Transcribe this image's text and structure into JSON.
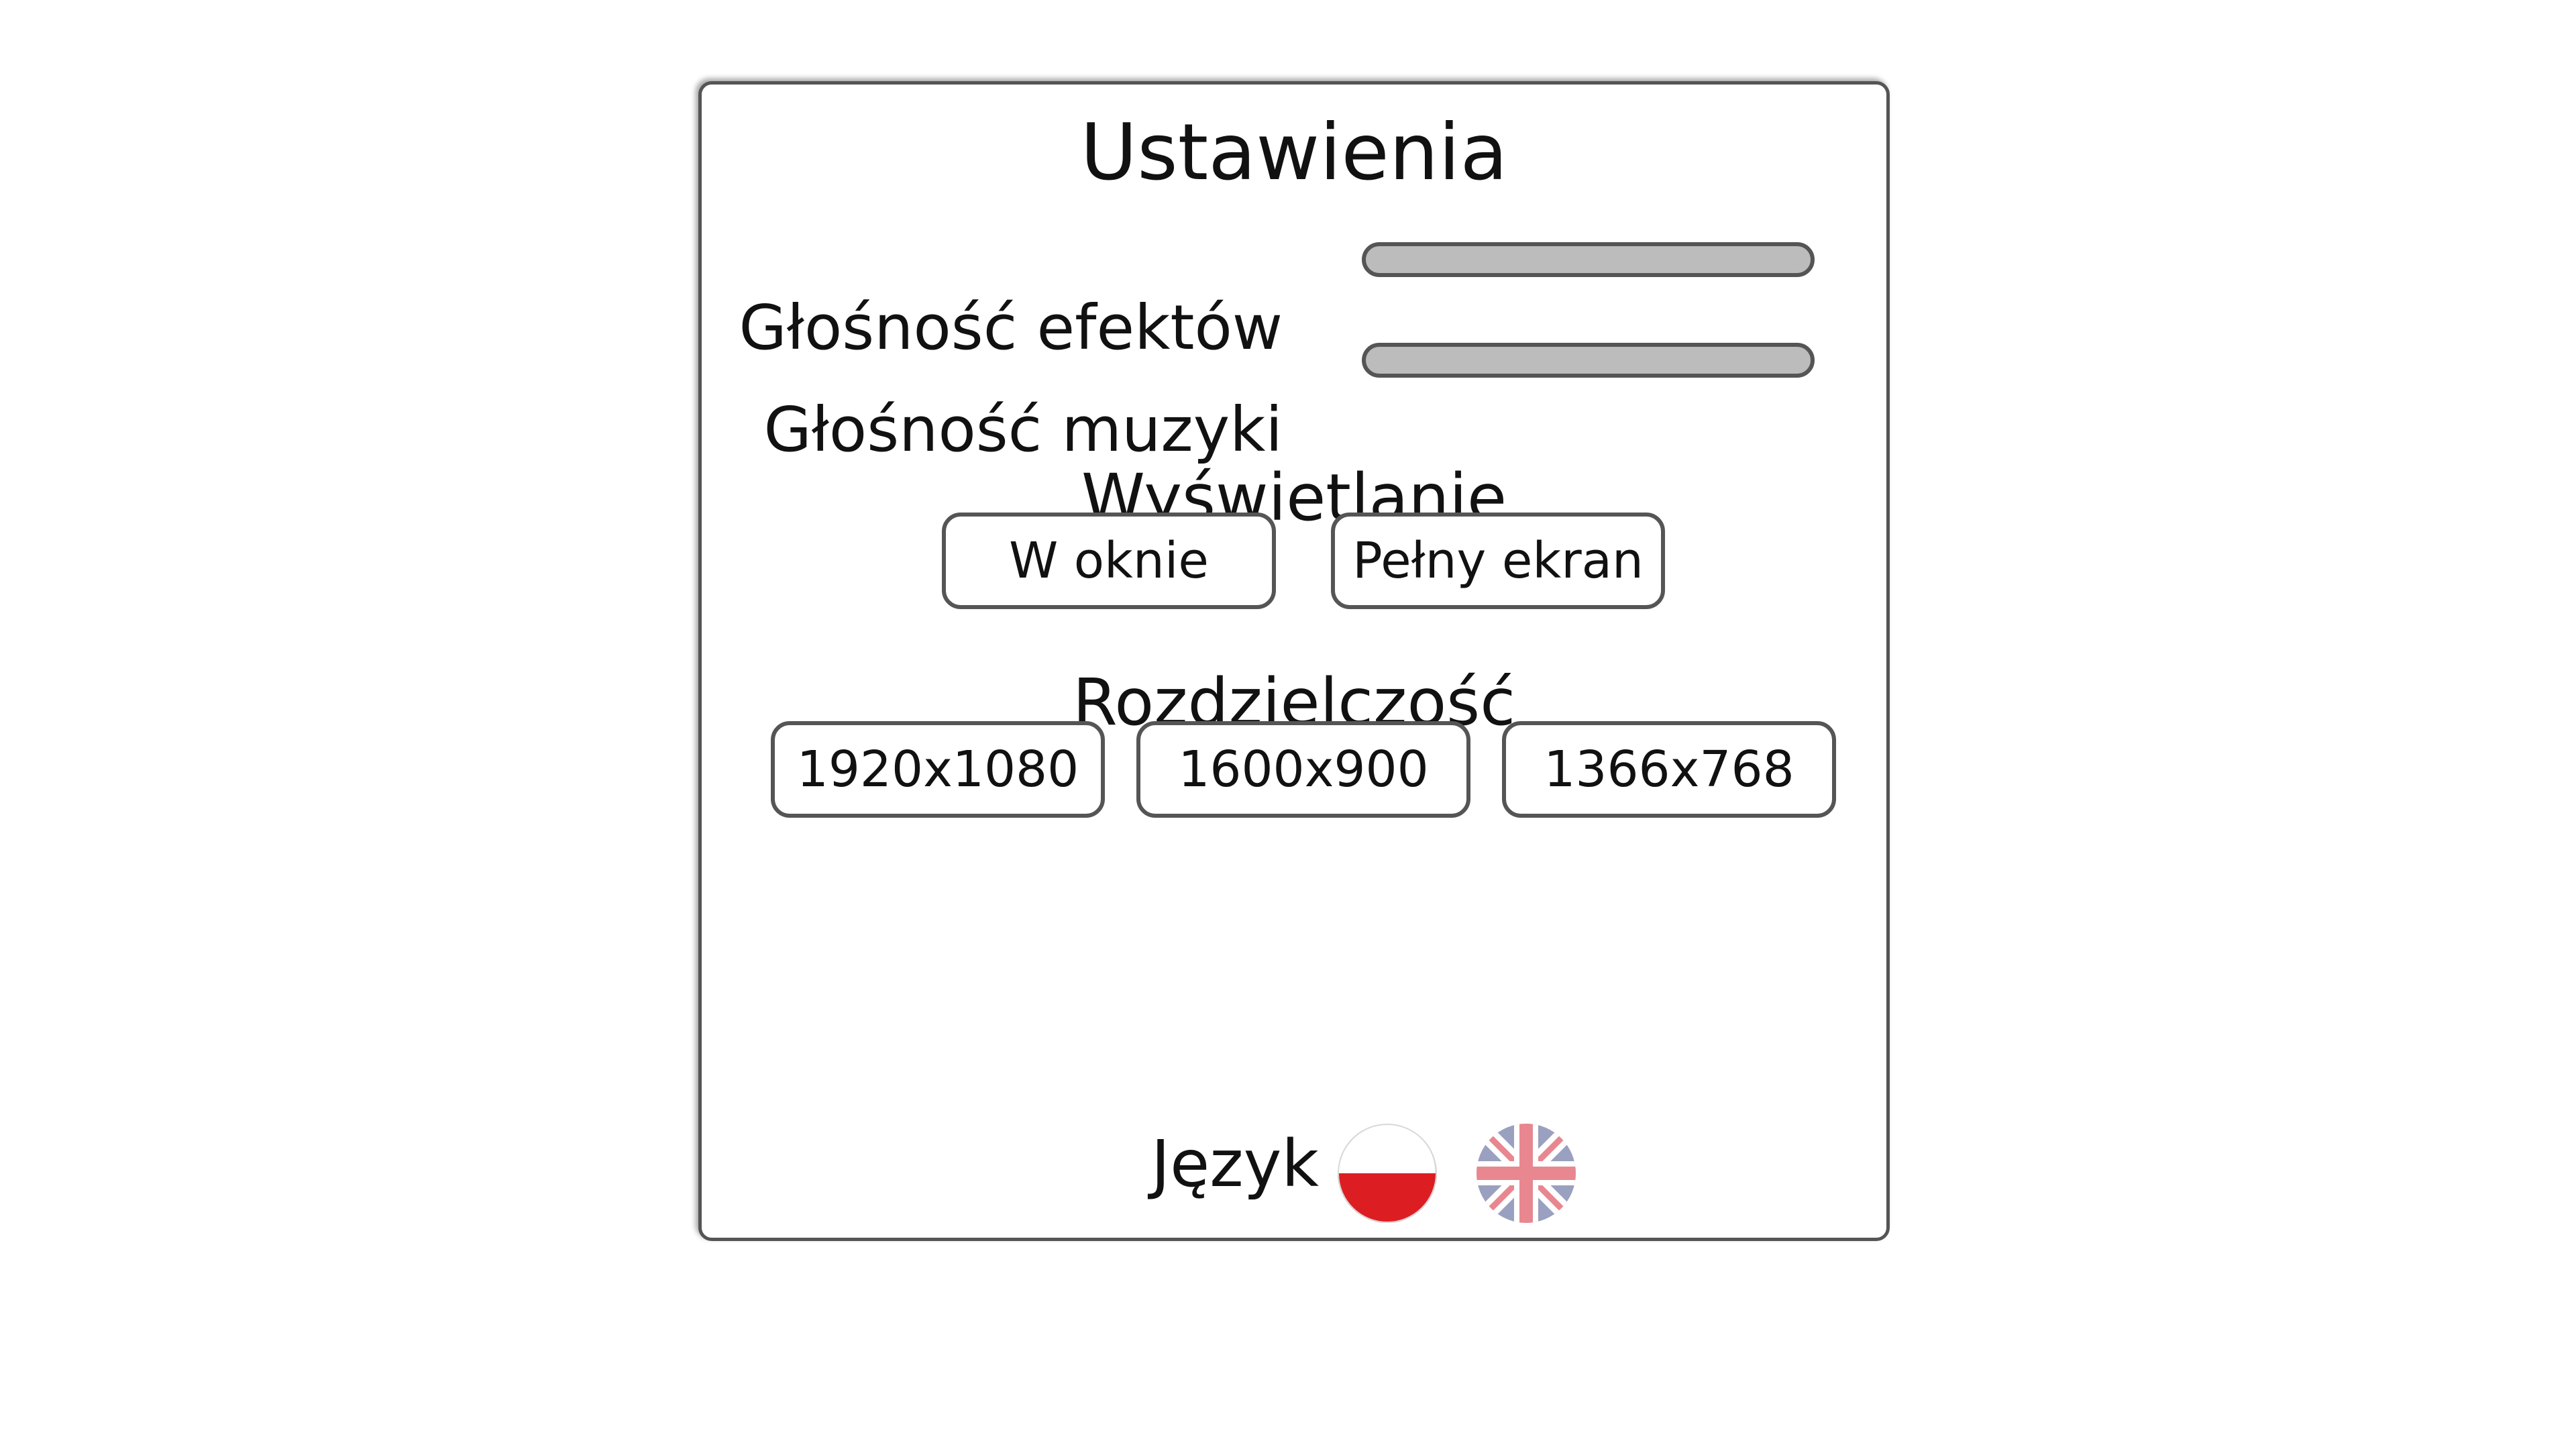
{
  "settings": {
    "title": "Ustawienia",
    "effects_volume_label": "Głośność efektów",
    "music_volume_label": "Głośność muzyki",
    "display_heading": "Wyświetlanie",
    "display_options": {
      "windowed": "W oknie",
      "fullscreen": "Pełny ekran"
    },
    "resolution_heading": "Rozdzielczość",
    "resolution_options": [
      "1920x1080",
      "1600x900",
      "1366x768"
    ],
    "language_label": "Język",
    "language_flags": [
      "polish-flag-icon",
      "uk-flag-icon"
    ]
  },
  "colors": {
    "panel_border": "#555555",
    "slider_fill": "#bcbcbc",
    "polish_red": "#dc1e23",
    "uk_blue": "#9aa0bf",
    "uk_red": "#e8878f"
  }
}
